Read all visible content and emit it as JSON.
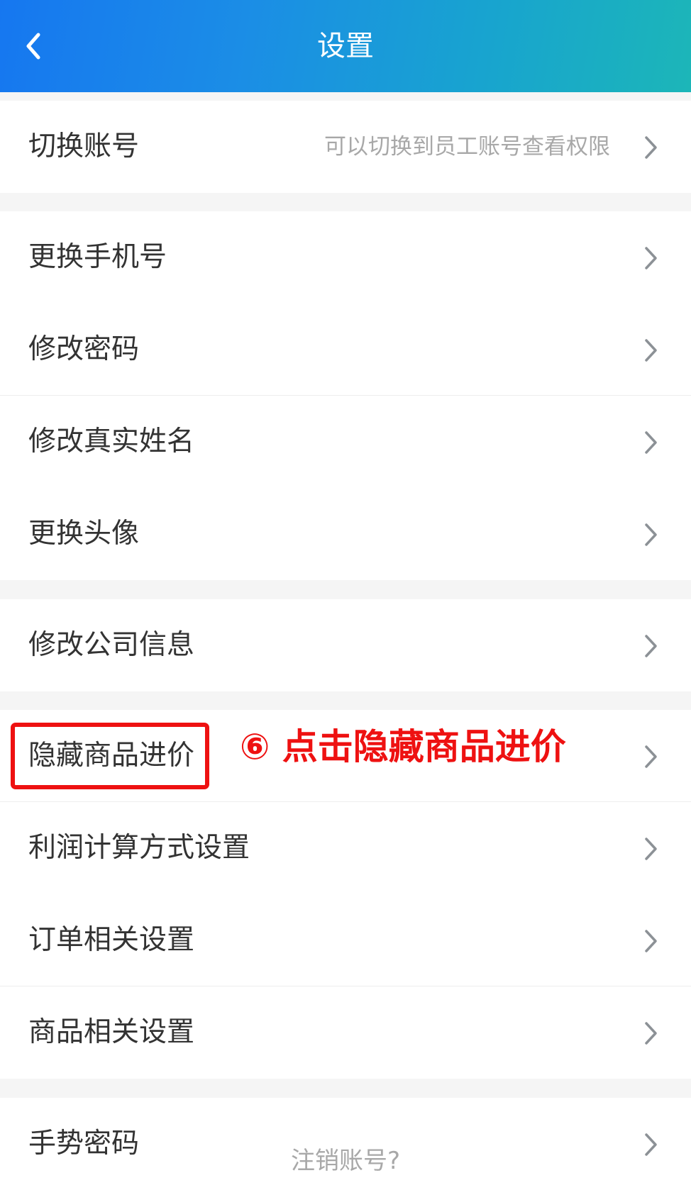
{
  "header": {
    "title": "设置",
    "back_icon": "chevron-left-icon"
  },
  "groups": [
    {
      "items": [
        {
          "label": "切换账号",
          "hint": "可以切换到员工账号查看权限"
        }
      ]
    },
    {
      "items": [
        {
          "label": "更换手机号"
        },
        {
          "label": "修改密码"
        },
        {
          "label": "修改真实姓名"
        },
        {
          "label": "更换头像"
        }
      ]
    },
    {
      "items": [
        {
          "label": "修改公司信息"
        }
      ]
    },
    {
      "items": [
        {
          "label": "隐藏商品进价"
        },
        {
          "label": "利润计算方式设置"
        },
        {
          "label": "订单相关设置"
        },
        {
          "label": "商品相关设置"
        }
      ]
    },
    {
      "items": [
        {
          "label": "手势密码"
        }
      ]
    }
  ],
  "annotation": {
    "text": "⑥ 点击隐藏商品进价",
    "color": "#ee1111"
  },
  "footer": {
    "cancel_account_label": "注销账号?"
  },
  "colors": {
    "header_gradient_start": "#1677f0",
    "header_gradient_end": "#1cb6b8",
    "row_text": "#333333",
    "hint_text": "#a8a8a8",
    "chevron": "#8c9196",
    "page_background": "#f5f5f5"
  },
  "icons": {
    "row_chevron": "chevron-right-icon"
  }
}
